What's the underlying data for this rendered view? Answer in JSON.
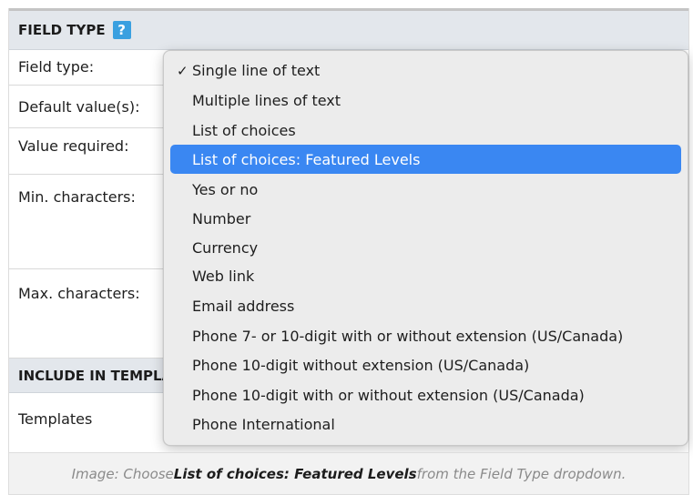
{
  "sections": {
    "field_type": {
      "title": "FIELD TYPE",
      "help": "?"
    },
    "include_in_templates": {
      "title": "INCLUDE IN TEMPLATES"
    }
  },
  "rows": {
    "field_type": "Field type:",
    "default_values": "Default value(s):",
    "value_required": "Value required:",
    "min_characters": "Min. characters:",
    "max_characters": "Max. characters:",
    "templates": "Templates"
  },
  "dropdown": {
    "checked_mark": "✓",
    "checked_index": 0,
    "highlighted_index": 3,
    "options": [
      "Single line of text",
      "Multiple lines of text",
      "List of choices",
      "List of choices: Featured Levels",
      "Yes or no",
      "Number",
      "Currency",
      "Web link",
      "Email address",
      "Phone 7- or 10-digit with or without extension (US/Canada)",
      "Phone 10-digit without extension (US/Canada)",
      "Phone 10-digit with or without extension (US/Canada)",
      "Phone International"
    ]
  },
  "caption": {
    "prefix": "Image: Choose ",
    "emphasis": "List of choices: Featured Levels",
    "suffix": " from the Field Type dropdown."
  },
  "colors": {
    "highlight": "#3a87f2",
    "help_icon": "#3aa0e0",
    "section_header_bg": "#e3e7ec"
  }
}
